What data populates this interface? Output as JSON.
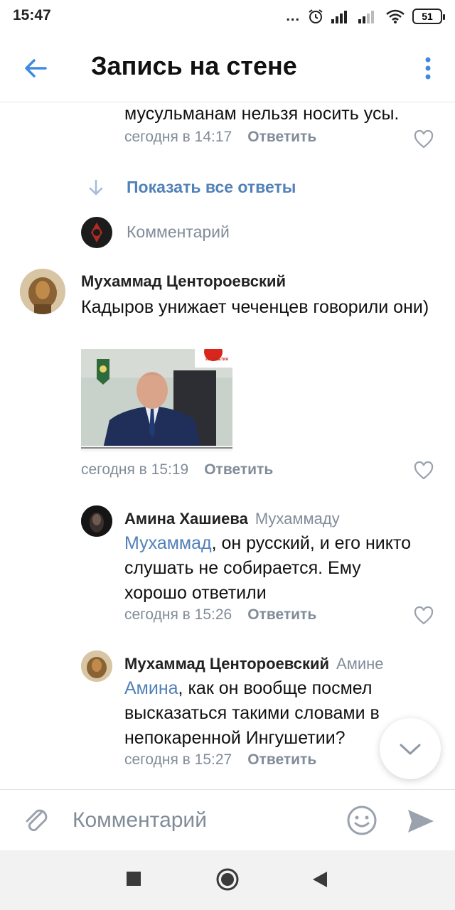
{
  "status_bar": {
    "time": "15:47",
    "dots": "...",
    "battery": "51",
    "icons": [
      "alarm-icon",
      "signal-icon",
      "signal-icon",
      "wifi-icon",
      "battery-icon"
    ]
  },
  "header": {
    "title": "Запись на стене"
  },
  "comments": {
    "partial": {
      "text": "мусульманам нельзя носить усы.",
      "time": "сегодня в 14:17",
      "reply": "Ответить"
    },
    "show_all": "Показать все ответы",
    "reply_input_placeholder": "Комментарий",
    "main": {
      "author": "Мухаммад Центороевский",
      "text": "Кадыров унижает чеченцев говорили они)",
      "photo_badge": "ИНГУШЕТИЯ",
      "time": "сегодня в 15:19",
      "reply": "Ответить"
    },
    "reply1": {
      "author": "Амина Хашиева",
      "to": "Мухаммаду",
      "mention": "Мухаммад",
      "text": ", он русский, и его никто слушать не собирается. Ему хорошо ответили",
      "time": "сегодня в 15:26",
      "reply": "Ответить"
    },
    "reply2": {
      "author": "Мухаммад Центороевский",
      "to": "Амине",
      "mention": "Амина",
      "text": ", как он вообще посмел высказаться такими словами в непокаренной Ингушетии?",
      "time": "сегодня в 15:27",
      "reply": "Ответить"
    }
  },
  "composer": {
    "placeholder": "Комментарий"
  },
  "colors": {
    "accent": "#5181b8",
    "muted": "#818c99",
    "back_arrow": "#3f8ae0"
  }
}
